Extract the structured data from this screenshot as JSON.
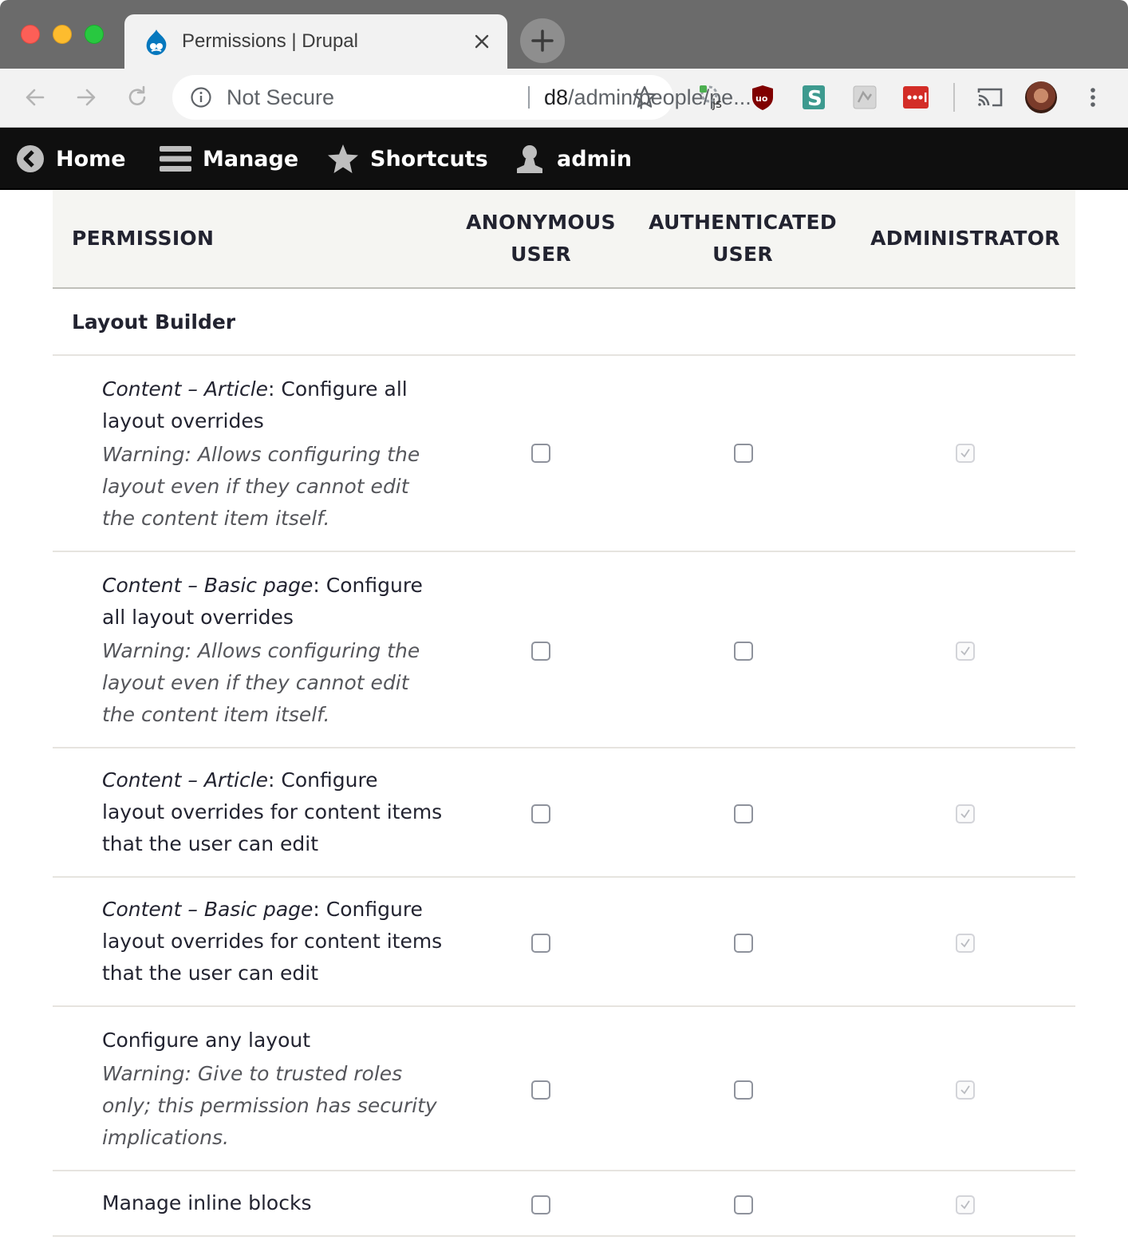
{
  "browser": {
    "tab_title": "Permissions | Drupal",
    "security_label": "Not Secure",
    "url_host": "d8",
    "url_path": "/admin/people/pe...",
    "extensions": [
      "js-icon",
      "ublock-icon",
      "s-extension-icon",
      "evernote-icon",
      "lastpass-icon"
    ]
  },
  "drupal_toolbar": {
    "home": "Home",
    "manage": "Manage",
    "shortcuts": "Shortcuts",
    "user": "admin"
  },
  "table": {
    "headers": {
      "permission": "Permission",
      "anonymous": "Anonymous user",
      "authenticated": "Authenticated user",
      "administrator": "Administrator"
    },
    "module": "Layout Builder",
    "rows": [
      {
        "title_prefix": "Content – Article",
        "title_suffix": ": Configure all layout overrides",
        "warning": "Warning: Allows configuring the layout even if they cannot edit the content item itself.",
        "anonymous": false,
        "authenticated": false,
        "administrator": true
      },
      {
        "title_prefix": "Content – Basic page",
        "title_suffix": ": Configure all layout overrides",
        "warning": "Warning: Allows configuring the layout even if they cannot edit the content item itself.",
        "anonymous": false,
        "authenticated": false,
        "administrator": true
      },
      {
        "title_prefix": "Content – Article",
        "title_suffix": ": Configure layout overrides for content items that the user can edit",
        "warning": "",
        "anonymous": false,
        "authenticated": false,
        "administrator": true
      },
      {
        "title_prefix": "Content – Basic page",
        "title_suffix": ": Configure layout overrides for content items that the user can edit",
        "warning": "",
        "anonymous": false,
        "authenticated": false,
        "administrator": true
      },
      {
        "title_prefix": "",
        "title_suffix": "Configure any layout",
        "warning": "Warning: Give to trusted roles only; this permission has security implications.",
        "anonymous": false,
        "authenticated": false,
        "administrator": true
      },
      {
        "title_prefix": "",
        "title_suffix": "Manage inline blocks",
        "warning": "",
        "anonymous": false,
        "authenticated": false,
        "administrator": true
      }
    ]
  },
  "colors": {
    "drupal_blue": "#0678be",
    "toolbar_black": "#0f0f0f",
    "header_bg": "#f5f5f2"
  }
}
